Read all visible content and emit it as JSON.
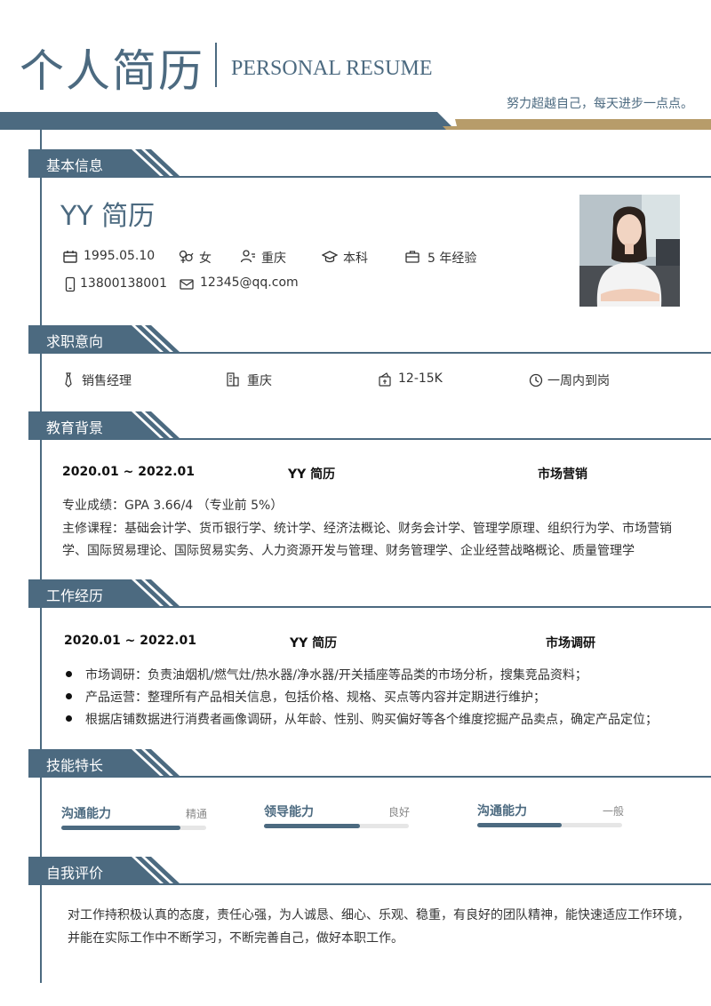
{
  "header": {
    "title_cn": "个人简历",
    "title_en": "PERSONAL RESUME",
    "motto": "努力超越自己，每天进步一点点。"
  },
  "colors": {
    "primary": "#4c6a80",
    "accent": "#b79c6a"
  },
  "sections": {
    "basic": "基本信息",
    "intent": "求职意向",
    "education": "教育背景",
    "work": "工作经历",
    "skills": "技能特长",
    "self": "自我评价"
  },
  "basic": {
    "name": "YY 简历",
    "birth": "1995.05.10",
    "gender": "女",
    "city": "重庆",
    "degree": "本科",
    "experience": "5 年经验",
    "phone": "13800138001",
    "email": "12345@qq.com"
  },
  "intent": {
    "position": "销售经理",
    "city": "重庆",
    "salary": "12-15K",
    "availability": "一周内到岗"
  },
  "education": {
    "period": "2020.01 ~ 2022.01",
    "school": "YY 简历",
    "major": "市场营销",
    "gpa": "专业成绩：GPA 3.66/4 （专业前 5%）",
    "courses_line1": "主修课程：基础会计学、货币银行学、统计学、经济法概论、财务会计学、管理学原理、组织行为学、市场营销",
    "courses_line2": "学、国际贸易理论、国际贸易实务、人力资源开发与管理、财务管理学、企业经营战略概论、质量管理学"
  },
  "work": {
    "period": "2020.01 ~ 2022.01",
    "company": "YY 简历",
    "role": "市场调研",
    "items": [
      "市场调研：负责油烟机/燃气灶/热水器/净水器/开关插座等品类的市场分析，搜集竞品资料；",
      "产品运营：整理所有产品相关信息，包括价格、规格、买点等内容并定期进行维护；",
      "根据店铺数据进行消费者画像调研，从年龄、性别、购买偏好等各个维度挖掘产品卖点，确定产品定位；"
    ]
  },
  "skills": [
    {
      "name": "沟通能力",
      "level": "精通",
      "fraction": 0.82
    },
    {
      "name": "领导能力",
      "level": "良好",
      "fraction": 0.66
    },
    {
      "name": "沟通能力",
      "level": "一般",
      "fraction": 0.58
    }
  ],
  "self_eval": {
    "line1": "对工作持积极认真的态度，责任心强，为人诚恳、细心、乐观、稳重，有良好的团队精神，能快速适应工作环境，",
    "line2": "并能在实际工作中不断学习，不断完善自己，做好本职工作。"
  }
}
